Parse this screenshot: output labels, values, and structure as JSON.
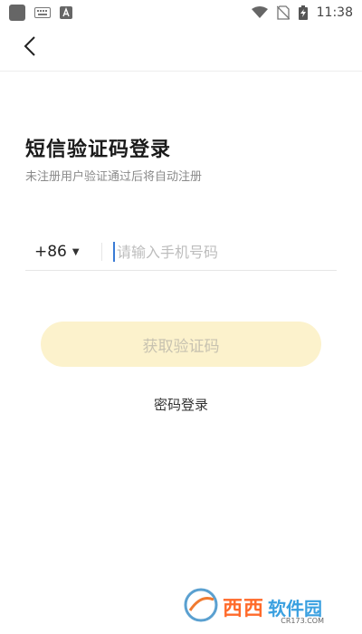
{
  "status_bar": {
    "time": "11:38"
  },
  "header": {
    "back_icon": "chevron-left-icon"
  },
  "login": {
    "title": "短信验证码登录",
    "subtitle": "未注册用户验证通过后将自动注册",
    "country_code": "+86",
    "phone_placeholder": "请输入手机号码",
    "get_code_label": "获取验证码",
    "password_login_label": "密码登录"
  },
  "colors": {
    "button_bg": "#fcf2cc",
    "button_text": "#c7c2b0",
    "cursor": "#3a7bd5"
  },
  "watermark": {
    "text_a": "西西",
    "text_b": "软件园",
    "sub": "CR173.COM"
  }
}
